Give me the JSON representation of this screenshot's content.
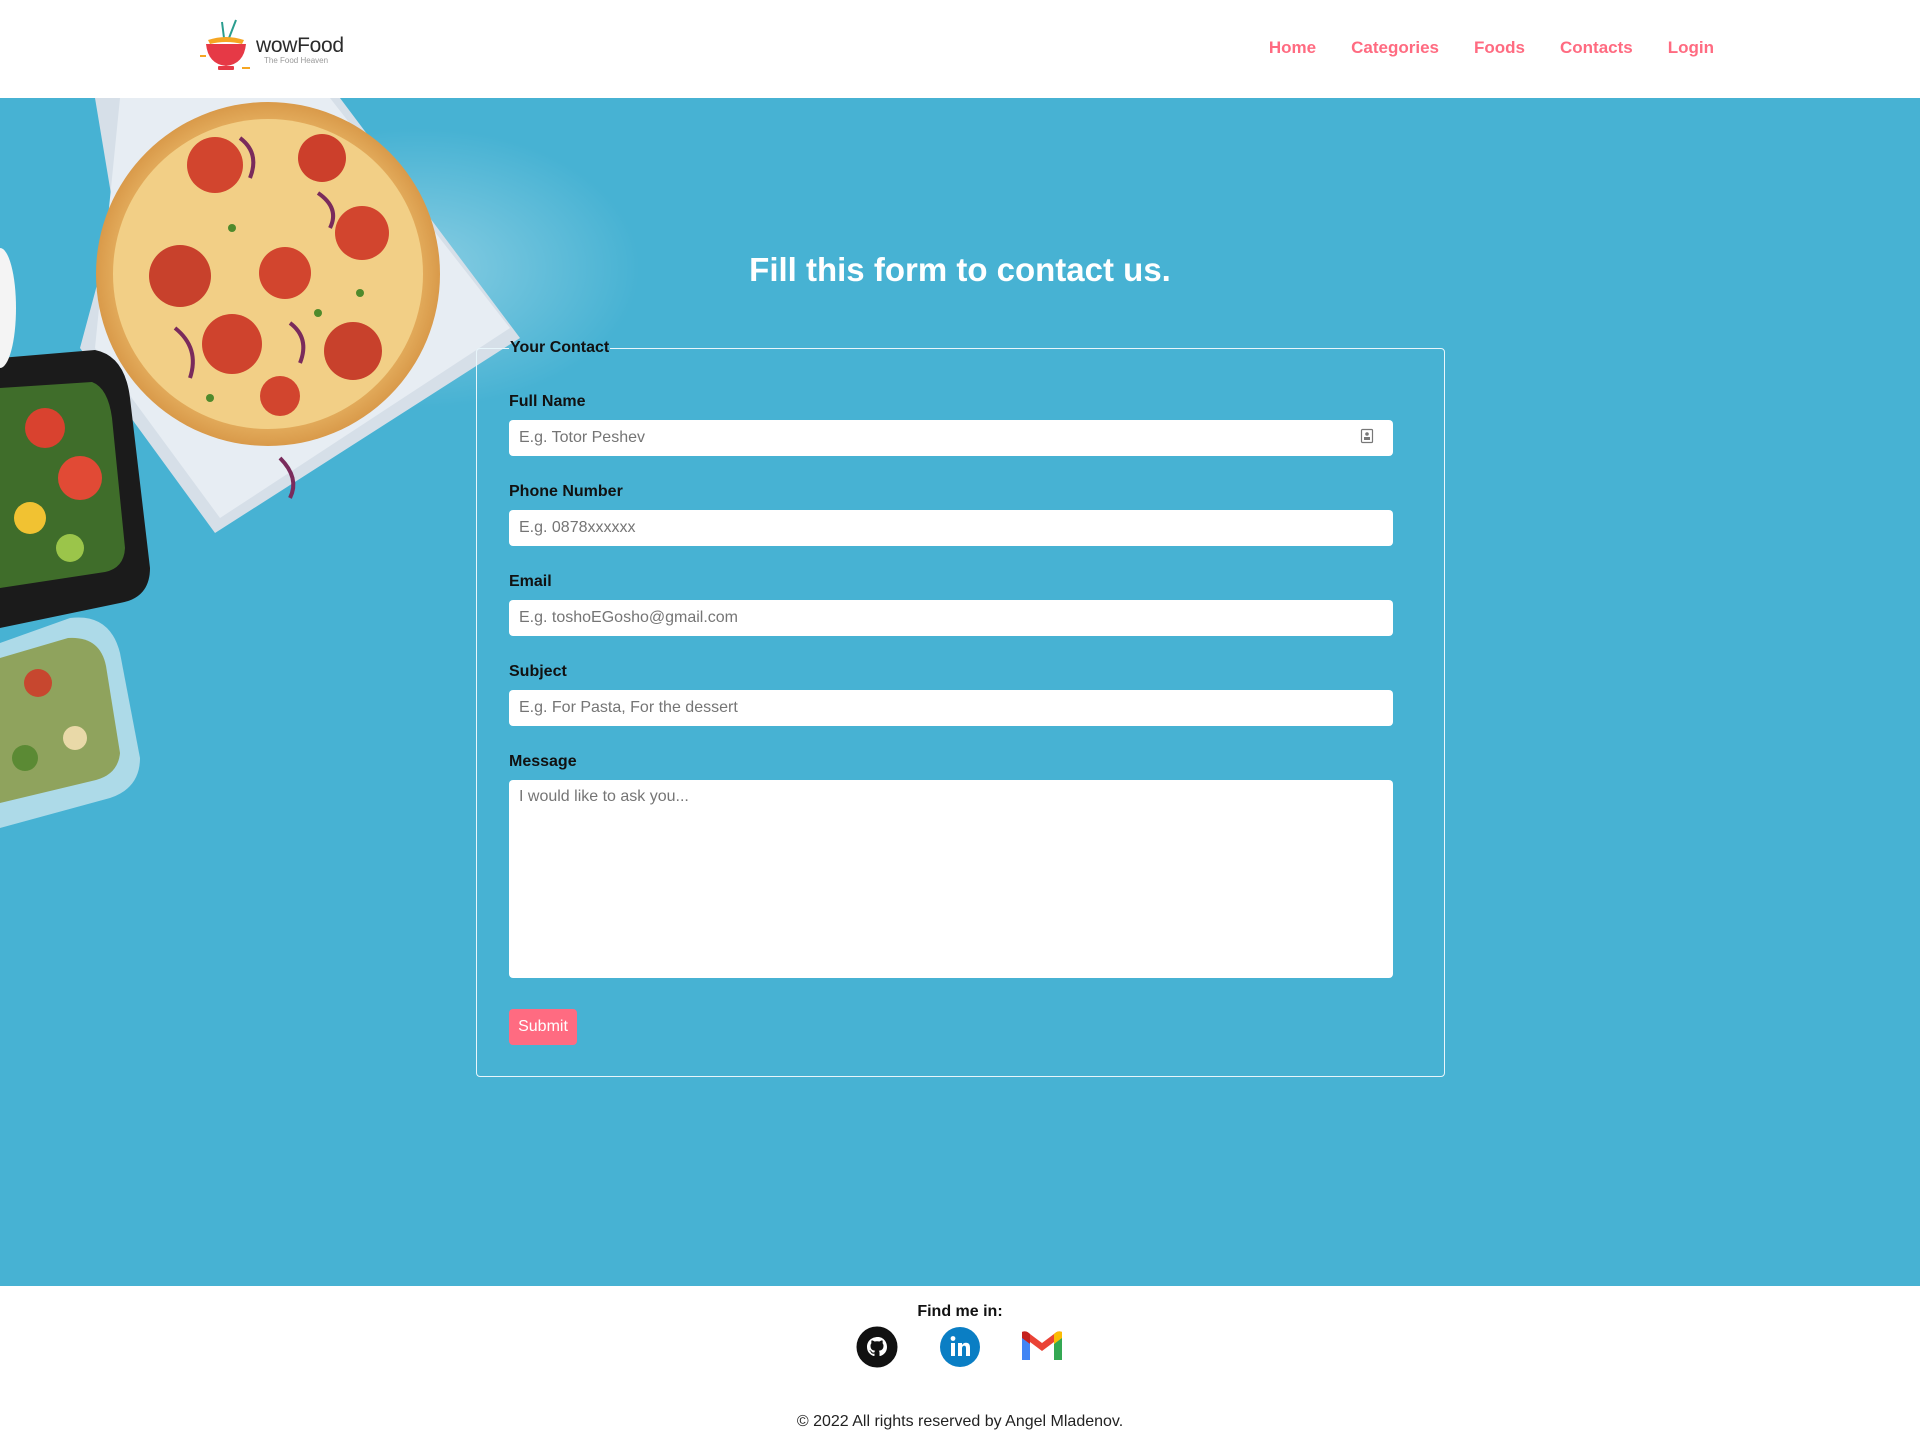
{
  "brand": {
    "name": "wowFood",
    "tagline": "The Food Heaven",
    "logo_icon": "noodle-bowl-icon"
  },
  "nav": {
    "items": [
      {
        "label": "Home"
      },
      {
        "label": "Categories"
      },
      {
        "label": "Foods"
      },
      {
        "label": "Contacts"
      },
      {
        "label": "Login"
      }
    ]
  },
  "hero": {
    "decoration": "food-photo-pizza-salad"
  },
  "form": {
    "title": "Fill this form to contact us.",
    "legend": "Your Contact",
    "fields": {
      "full_name": {
        "label": "Full Name",
        "placeholder": "E.g. Totor Peshev",
        "value": ""
      },
      "phone": {
        "label": "Phone Number",
        "placeholder": "E.g. 0878xxxxxx",
        "value": ""
      },
      "email": {
        "label": "Email",
        "placeholder": "E.g. toshoEGosho@gmail.com",
        "value": ""
      },
      "subject": {
        "label": "Subject",
        "placeholder": "E.g. For Pasta, For the dessert",
        "value": ""
      },
      "message": {
        "label": "Message",
        "placeholder": "I would like to ask you...",
        "value": ""
      }
    },
    "submit_label": "Submit"
  },
  "footer": {
    "find_me": "Find me in:",
    "social": [
      {
        "icon": "github-icon"
      },
      {
        "icon": "linkedin-icon"
      },
      {
        "icon": "gmail-icon"
      }
    ],
    "copyright": "© 2022 All rights reserved by Angel Mladenov."
  },
  "colors": {
    "accent": "#ff6b81",
    "main_background": "#47b2d3",
    "white": "#ffffff"
  }
}
